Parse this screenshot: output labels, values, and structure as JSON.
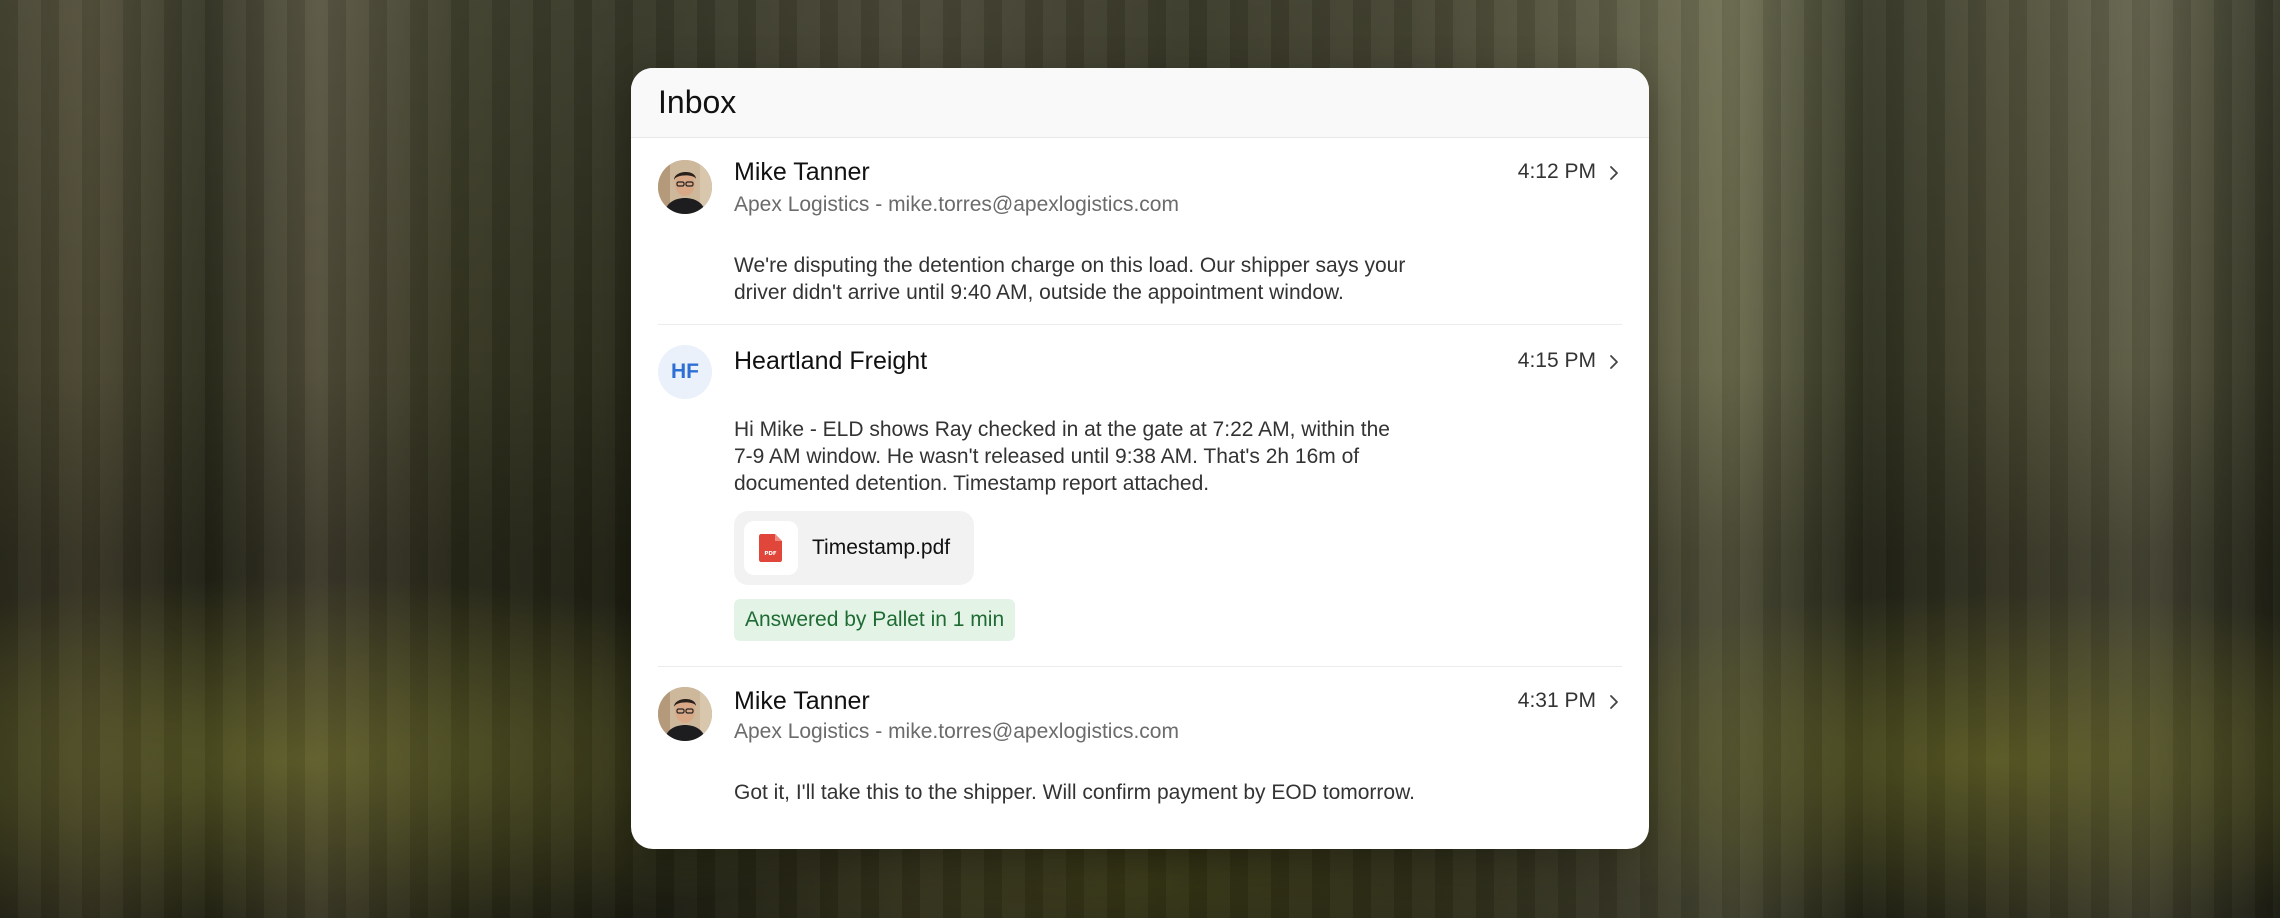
{
  "inbox": {
    "title": "Inbox"
  },
  "messages": [
    {
      "sender": "Mike Tanner",
      "company_email": "Apex Logistics - mike.torres@apexlogistics.com",
      "time": "4:12 PM",
      "body": "We're disputing the detention charge on this load. Our shipper says your driver didn't arrive until 9:40 AM, outside the appointment window."
    },
    {
      "sender": "Heartland Freight",
      "initials": "HF",
      "time": "4:15 PM",
      "body": "Hi Mike - ELD shows Ray checked in at the gate at 7:22 AM, within the 7-9 AM window. He wasn't released until 9:38 AM. That's 2h 16m of documented detention. Timestamp report attached.",
      "attachment": {
        "file_name": "Timestamp.pdf",
        "file_type_label": "PDF"
      },
      "badge": "Answered by Pallet in 1 min"
    },
    {
      "sender": "Mike Tanner",
      "company_email": "Apex Logistics - mike.torres@apexlogistics.com",
      "time": "4:31 PM",
      "body": "Got it, I'll take this to the shipper. Will confirm payment by EOD tomorrow."
    }
  ],
  "colors": {
    "badge_bg": "#e3f4e7",
    "badge_text": "#1f6b34",
    "initials_bg": "#eaf1fb",
    "initials_text": "#2e6fd6",
    "pdf_red": "#e0473a"
  },
  "icons": {
    "row_chevron": "chevron-right-icon",
    "file": "pdf-file-icon"
  }
}
